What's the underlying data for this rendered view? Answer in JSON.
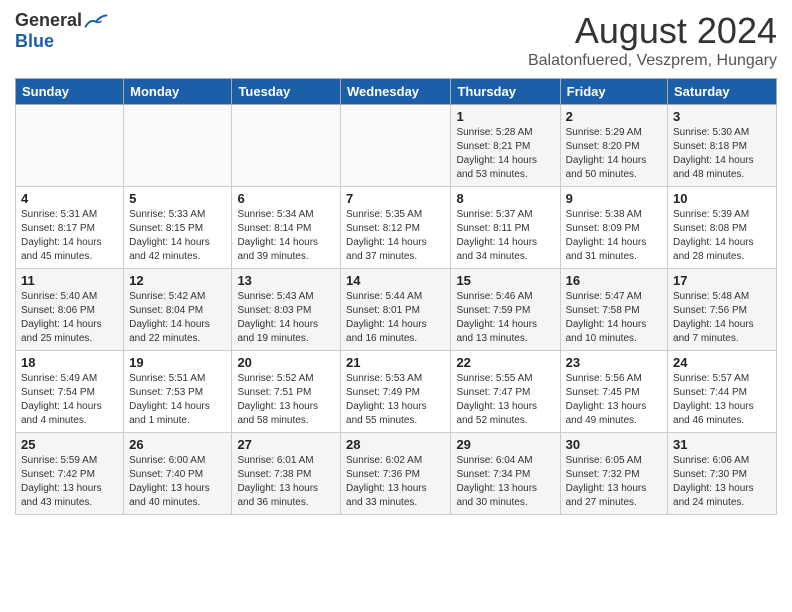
{
  "header": {
    "logo_general": "General",
    "logo_blue": "Blue",
    "month_title": "August 2024",
    "subtitle": "Balatonfuered, Veszprem, Hungary"
  },
  "days_of_week": [
    "Sunday",
    "Monday",
    "Tuesday",
    "Wednesday",
    "Thursday",
    "Friday",
    "Saturday"
  ],
  "weeks": [
    [
      {
        "day": "",
        "info": ""
      },
      {
        "day": "",
        "info": ""
      },
      {
        "day": "",
        "info": ""
      },
      {
        "day": "",
        "info": ""
      },
      {
        "day": "1",
        "info": "Sunrise: 5:28 AM\nSunset: 8:21 PM\nDaylight: 14 hours\nand 53 minutes."
      },
      {
        "day": "2",
        "info": "Sunrise: 5:29 AM\nSunset: 8:20 PM\nDaylight: 14 hours\nand 50 minutes."
      },
      {
        "day": "3",
        "info": "Sunrise: 5:30 AM\nSunset: 8:18 PM\nDaylight: 14 hours\nand 48 minutes."
      }
    ],
    [
      {
        "day": "4",
        "info": "Sunrise: 5:31 AM\nSunset: 8:17 PM\nDaylight: 14 hours\nand 45 minutes."
      },
      {
        "day": "5",
        "info": "Sunrise: 5:33 AM\nSunset: 8:15 PM\nDaylight: 14 hours\nand 42 minutes."
      },
      {
        "day": "6",
        "info": "Sunrise: 5:34 AM\nSunset: 8:14 PM\nDaylight: 14 hours\nand 39 minutes."
      },
      {
        "day": "7",
        "info": "Sunrise: 5:35 AM\nSunset: 8:12 PM\nDaylight: 14 hours\nand 37 minutes."
      },
      {
        "day": "8",
        "info": "Sunrise: 5:37 AM\nSunset: 8:11 PM\nDaylight: 14 hours\nand 34 minutes."
      },
      {
        "day": "9",
        "info": "Sunrise: 5:38 AM\nSunset: 8:09 PM\nDaylight: 14 hours\nand 31 minutes."
      },
      {
        "day": "10",
        "info": "Sunrise: 5:39 AM\nSunset: 8:08 PM\nDaylight: 14 hours\nand 28 minutes."
      }
    ],
    [
      {
        "day": "11",
        "info": "Sunrise: 5:40 AM\nSunset: 8:06 PM\nDaylight: 14 hours\nand 25 minutes."
      },
      {
        "day": "12",
        "info": "Sunrise: 5:42 AM\nSunset: 8:04 PM\nDaylight: 14 hours\nand 22 minutes."
      },
      {
        "day": "13",
        "info": "Sunrise: 5:43 AM\nSunset: 8:03 PM\nDaylight: 14 hours\nand 19 minutes."
      },
      {
        "day": "14",
        "info": "Sunrise: 5:44 AM\nSunset: 8:01 PM\nDaylight: 14 hours\nand 16 minutes."
      },
      {
        "day": "15",
        "info": "Sunrise: 5:46 AM\nSunset: 7:59 PM\nDaylight: 14 hours\nand 13 minutes."
      },
      {
        "day": "16",
        "info": "Sunrise: 5:47 AM\nSunset: 7:58 PM\nDaylight: 14 hours\nand 10 minutes."
      },
      {
        "day": "17",
        "info": "Sunrise: 5:48 AM\nSunset: 7:56 PM\nDaylight: 14 hours\nand 7 minutes."
      }
    ],
    [
      {
        "day": "18",
        "info": "Sunrise: 5:49 AM\nSunset: 7:54 PM\nDaylight: 14 hours\nand 4 minutes."
      },
      {
        "day": "19",
        "info": "Sunrise: 5:51 AM\nSunset: 7:53 PM\nDaylight: 14 hours\nand 1 minute."
      },
      {
        "day": "20",
        "info": "Sunrise: 5:52 AM\nSunset: 7:51 PM\nDaylight: 13 hours\nand 58 minutes."
      },
      {
        "day": "21",
        "info": "Sunrise: 5:53 AM\nSunset: 7:49 PM\nDaylight: 13 hours\nand 55 minutes."
      },
      {
        "day": "22",
        "info": "Sunrise: 5:55 AM\nSunset: 7:47 PM\nDaylight: 13 hours\nand 52 minutes."
      },
      {
        "day": "23",
        "info": "Sunrise: 5:56 AM\nSunset: 7:45 PM\nDaylight: 13 hours\nand 49 minutes."
      },
      {
        "day": "24",
        "info": "Sunrise: 5:57 AM\nSunset: 7:44 PM\nDaylight: 13 hours\nand 46 minutes."
      }
    ],
    [
      {
        "day": "25",
        "info": "Sunrise: 5:59 AM\nSunset: 7:42 PM\nDaylight: 13 hours\nand 43 minutes."
      },
      {
        "day": "26",
        "info": "Sunrise: 6:00 AM\nSunset: 7:40 PM\nDaylight: 13 hours\nand 40 minutes."
      },
      {
        "day": "27",
        "info": "Sunrise: 6:01 AM\nSunset: 7:38 PM\nDaylight: 13 hours\nand 36 minutes."
      },
      {
        "day": "28",
        "info": "Sunrise: 6:02 AM\nSunset: 7:36 PM\nDaylight: 13 hours\nand 33 minutes."
      },
      {
        "day": "29",
        "info": "Sunrise: 6:04 AM\nSunset: 7:34 PM\nDaylight: 13 hours\nand 30 minutes."
      },
      {
        "day": "30",
        "info": "Sunrise: 6:05 AM\nSunset: 7:32 PM\nDaylight: 13 hours\nand 27 minutes."
      },
      {
        "day": "31",
        "info": "Sunrise: 6:06 AM\nSunset: 7:30 PM\nDaylight: 13 hours\nand 24 minutes."
      }
    ]
  ]
}
